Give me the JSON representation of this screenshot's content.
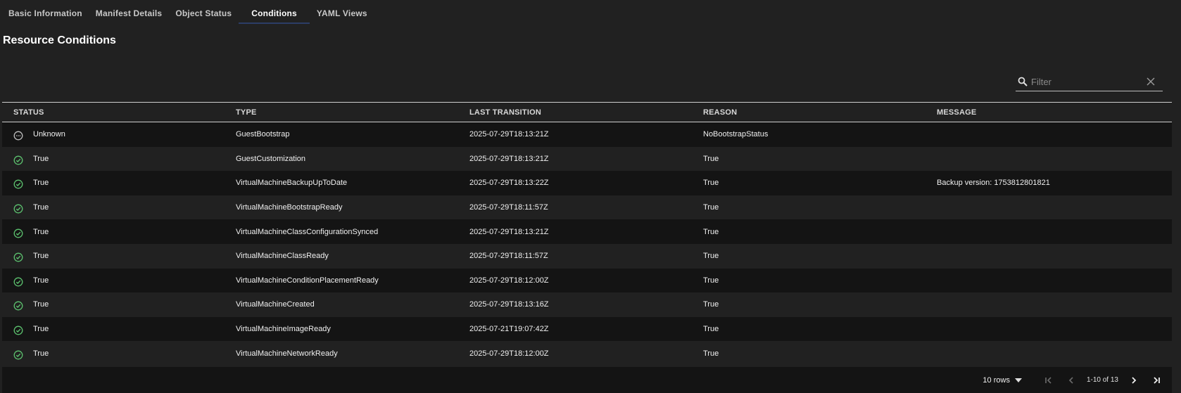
{
  "tabs": [
    {
      "label": "Basic Information",
      "active": false
    },
    {
      "label": "Manifest Details",
      "active": false
    },
    {
      "label": "Object Status",
      "active": false
    },
    {
      "label": "Conditions",
      "active": true
    },
    {
      "label": "YAML Views",
      "active": false
    }
  ],
  "page": {
    "title": "Resource Conditions"
  },
  "filter": {
    "placeholder": "Filter",
    "value": ""
  },
  "table": {
    "columns": [
      "STATUS",
      "TYPE",
      "LAST TRANSITION",
      "REASON",
      "MESSAGE"
    ],
    "rows": [
      {
        "status": "Unknown",
        "status_icon": "unknown-circle-icon",
        "type": "GuestBootstrap",
        "last_transition": "2025-07-29T18:13:21Z",
        "reason": "NoBootstrapStatus",
        "message": ""
      },
      {
        "status": "True",
        "status_icon": "check-circle-icon",
        "type": "GuestCustomization",
        "last_transition": "2025-07-29T18:13:21Z",
        "reason": "True",
        "message": ""
      },
      {
        "status": "True",
        "status_icon": "check-circle-icon",
        "type": "VirtualMachineBackupUpToDate",
        "last_transition": "2025-07-29T18:13:22Z",
        "reason": "True",
        "message": "Backup version: 1753812801821"
      },
      {
        "status": "True",
        "status_icon": "check-circle-icon",
        "type": "VirtualMachineBootstrapReady",
        "last_transition": "2025-07-29T18:11:57Z",
        "reason": "True",
        "message": ""
      },
      {
        "status": "True",
        "status_icon": "check-circle-icon",
        "type": "VirtualMachineClassConfigurationSynced",
        "last_transition": "2025-07-29T18:13:21Z",
        "reason": "True",
        "message": ""
      },
      {
        "status": "True",
        "status_icon": "check-circle-icon",
        "type": "VirtualMachineClassReady",
        "last_transition": "2025-07-29T18:11:57Z",
        "reason": "True",
        "message": ""
      },
      {
        "status": "True",
        "status_icon": "check-circle-icon",
        "type": "VirtualMachineConditionPlacementReady",
        "last_transition": "2025-07-29T18:12:00Z",
        "reason": "True",
        "message": ""
      },
      {
        "status": "True",
        "status_icon": "check-circle-icon",
        "type": "VirtualMachineCreated",
        "last_transition": "2025-07-29T18:13:16Z",
        "reason": "True",
        "message": ""
      },
      {
        "status": "True",
        "status_icon": "check-circle-icon",
        "type": "VirtualMachineImageReady",
        "last_transition": "2025-07-21T19:07:42Z",
        "reason": "True",
        "message": ""
      },
      {
        "status": "True",
        "status_icon": "check-circle-icon",
        "type": "VirtualMachineNetworkReady",
        "last_transition": "2025-07-29T18:12:00Z",
        "reason": "True",
        "message": ""
      }
    ]
  },
  "pagination": {
    "rows_per_page": "10 rows",
    "range": "1-10 of 13"
  },
  "colors": {
    "success": "#5cc16e",
    "unknown": "#bdbdbd",
    "tab_underline": "#2c3d66"
  }
}
